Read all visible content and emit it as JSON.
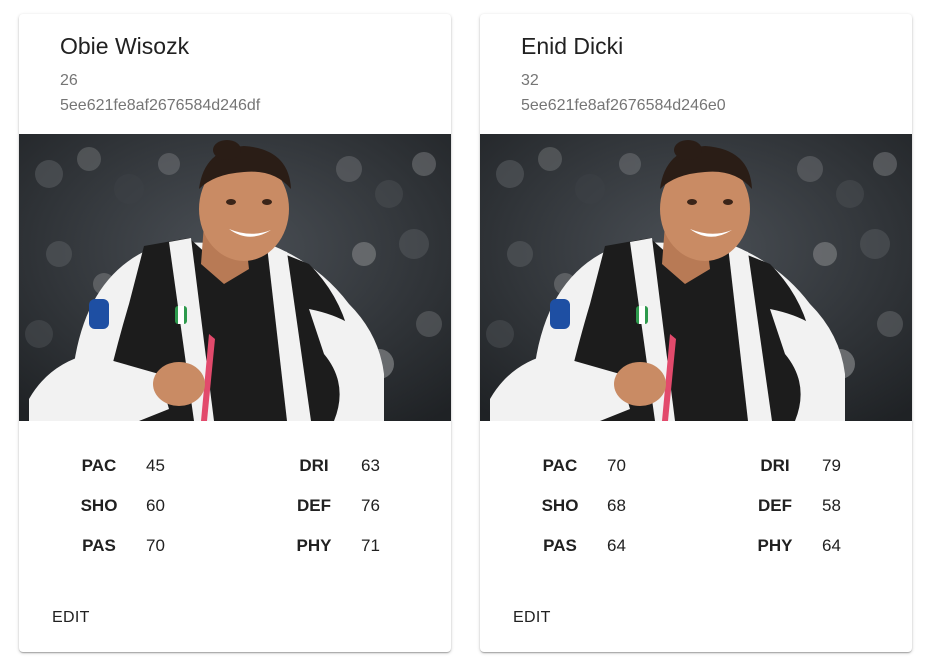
{
  "cards": [
    {
      "name": "Obie Wisozk",
      "age": "26",
      "id": "5ee621fe8af2676584d246df",
      "image_alt": "Player photo",
      "stats": [
        {
          "label": "PAC",
          "value": "45"
        },
        {
          "label": "SHO",
          "value": "60"
        },
        {
          "label": "PAS",
          "value": "70"
        },
        {
          "label": "DRI",
          "value": "63"
        },
        {
          "label": "DEF",
          "value": "76"
        },
        {
          "label": "PHY",
          "value": "71"
        }
      ],
      "edit_label": "EDIT"
    },
    {
      "name": "Enid Dicki",
      "age": "32",
      "id": "5ee621fe8af2676584d246e0",
      "image_alt": "Player photo",
      "stats": [
        {
          "label": "PAC",
          "value": "70"
        },
        {
          "label": "SHO",
          "value": "68"
        },
        {
          "label": "PAS",
          "value": "64"
        },
        {
          "label": "DRI",
          "value": "79"
        },
        {
          "label": "DEF",
          "value": "58"
        },
        {
          "label": "PHY",
          "value": "64"
        }
      ],
      "edit_label": "EDIT"
    }
  ],
  "colors": {
    "jersey_black": "#1c1c1c",
    "jersey_white": "#f2f2f2",
    "skin": "#c98b64",
    "hair": "#2a1d16",
    "crowd_dark": "#2b2f33",
    "accent_pink": "#e24a6c",
    "text_primary": "#212121",
    "text_secondary": "#757575"
  }
}
